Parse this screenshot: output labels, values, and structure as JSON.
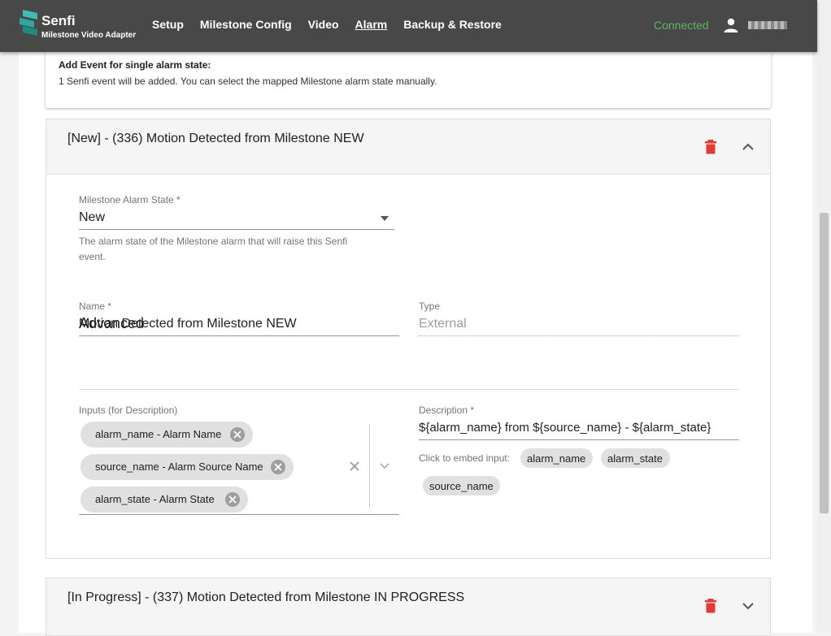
{
  "header": {
    "brand": "Senfi",
    "brand_sub": "Milestone Video Adapter",
    "nav": [
      "Setup",
      "Milestone Config",
      "Video",
      "Alarm",
      "Backup & Restore"
    ],
    "active_nav": "Alarm",
    "status": "Connected",
    "status_color": "#5db55d",
    "user_icon": "person-icon"
  },
  "info": {
    "title": "Add Event for single alarm state:",
    "text": "1 Senfi event will be added. You can select the mapped Milestone alarm state manually."
  },
  "event1": {
    "title": "[New] - (336) Motion Detected from Milestone NEW",
    "alarm_state_label": "Milestone Alarm State *",
    "alarm_state_value": "New",
    "alarm_state_help_1": "The alarm state of the Milestone alarm that will raise this Senfi",
    "alarm_state_help_2": "event.",
    "name_label": "Name *",
    "name_value": "Motion Detected from Milestone NEW",
    "type_label": "Type",
    "type_value": "External",
    "advanced_title": "Advanced",
    "inputs_label": "Inputs (for Description)",
    "input_chips": [
      "alarm_name - Alarm Name",
      "source_name - Alarm Source Name",
      "alarm_state - Alarm State"
    ],
    "description_label": "Description *",
    "description_value": "${alarm_name} from ${source_name} - ${alarm_state}",
    "embed_label": "Click to embed input:",
    "embed_chips": [
      "alarm_name",
      "alarm_state",
      "source_name"
    ]
  },
  "event2": {
    "title": "[In Progress] - (337) Motion Detected from Milestone IN PROGRESS"
  },
  "colors": {
    "topbar": "#484848",
    "delete": "#e53935",
    "logo": "#2fa79a"
  }
}
